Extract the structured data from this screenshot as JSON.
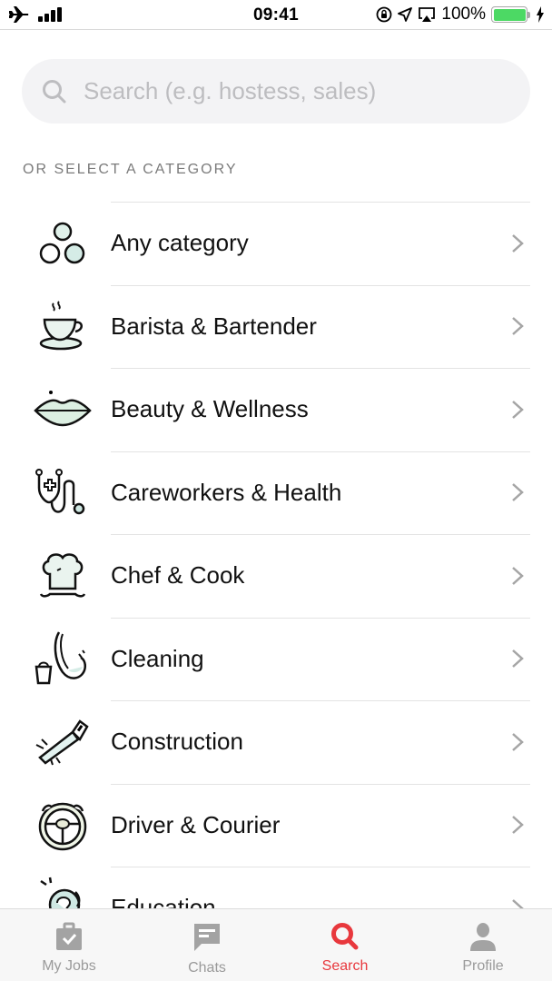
{
  "status_bar": {
    "time": "09:41",
    "battery_percent": "100%",
    "battery_level": 1.0,
    "icons": [
      "airplane-icon",
      "signal-icon",
      "orientation-lock-icon",
      "location-icon",
      "airplay-icon",
      "battery-icon",
      "charging-icon"
    ]
  },
  "search": {
    "placeholder": "Search (e.g. hostess, sales)",
    "value": ""
  },
  "section_label": "OR SELECT A CATEGORY",
  "categories": [
    {
      "label": "Any category",
      "icon": "three-circles-icon"
    },
    {
      "label": "Barista & Bartender",
      "icon": "coffee-cup-icon"
    },
    {
      "label": "Beauty & Wellness",
      "icon": "lips-icon"
    },
    {
      "label": "Careworkers & Health",
      "icon": "stethoscope-icon"
    },
    {
      "label": "Chef & Cook",
      "icon": "chef-hat-icon"
    },
    {
      "label": "Cleaning",
      "icon": "mop-bucket-icon"
    },
    {
      "label": "Construction",
      "icon": "saw-icon"
    },
    {
      "label": "Driver & Courier",
      "icon": "steering-wheel-icon"
    },
    {
      "label": "Education",
      "icon": "lightbulb-head-icon"
    }
  ],
  "tabs": [
    {
      "label": "My Jobs",
      "icon": "briefcase-check-icon",
      "active": false
    },
    {
      "label": "Chats",
      "icon": "chat-bubble-icon",
      "active": false
    },
    {
      "label": "Search",
      "icon": "search-icon",
      "active": true
    },
    {
      "label": "Profile",
      "icon": "person-icon",
      "active": false
    }
  ],
  "colors": {
    "accent": "#e8383d",
    "inactive_tab": "#9a9a9a",
    "battery": "#4cd964",
    "icon_tint": "#cfe8de"
  }
}
